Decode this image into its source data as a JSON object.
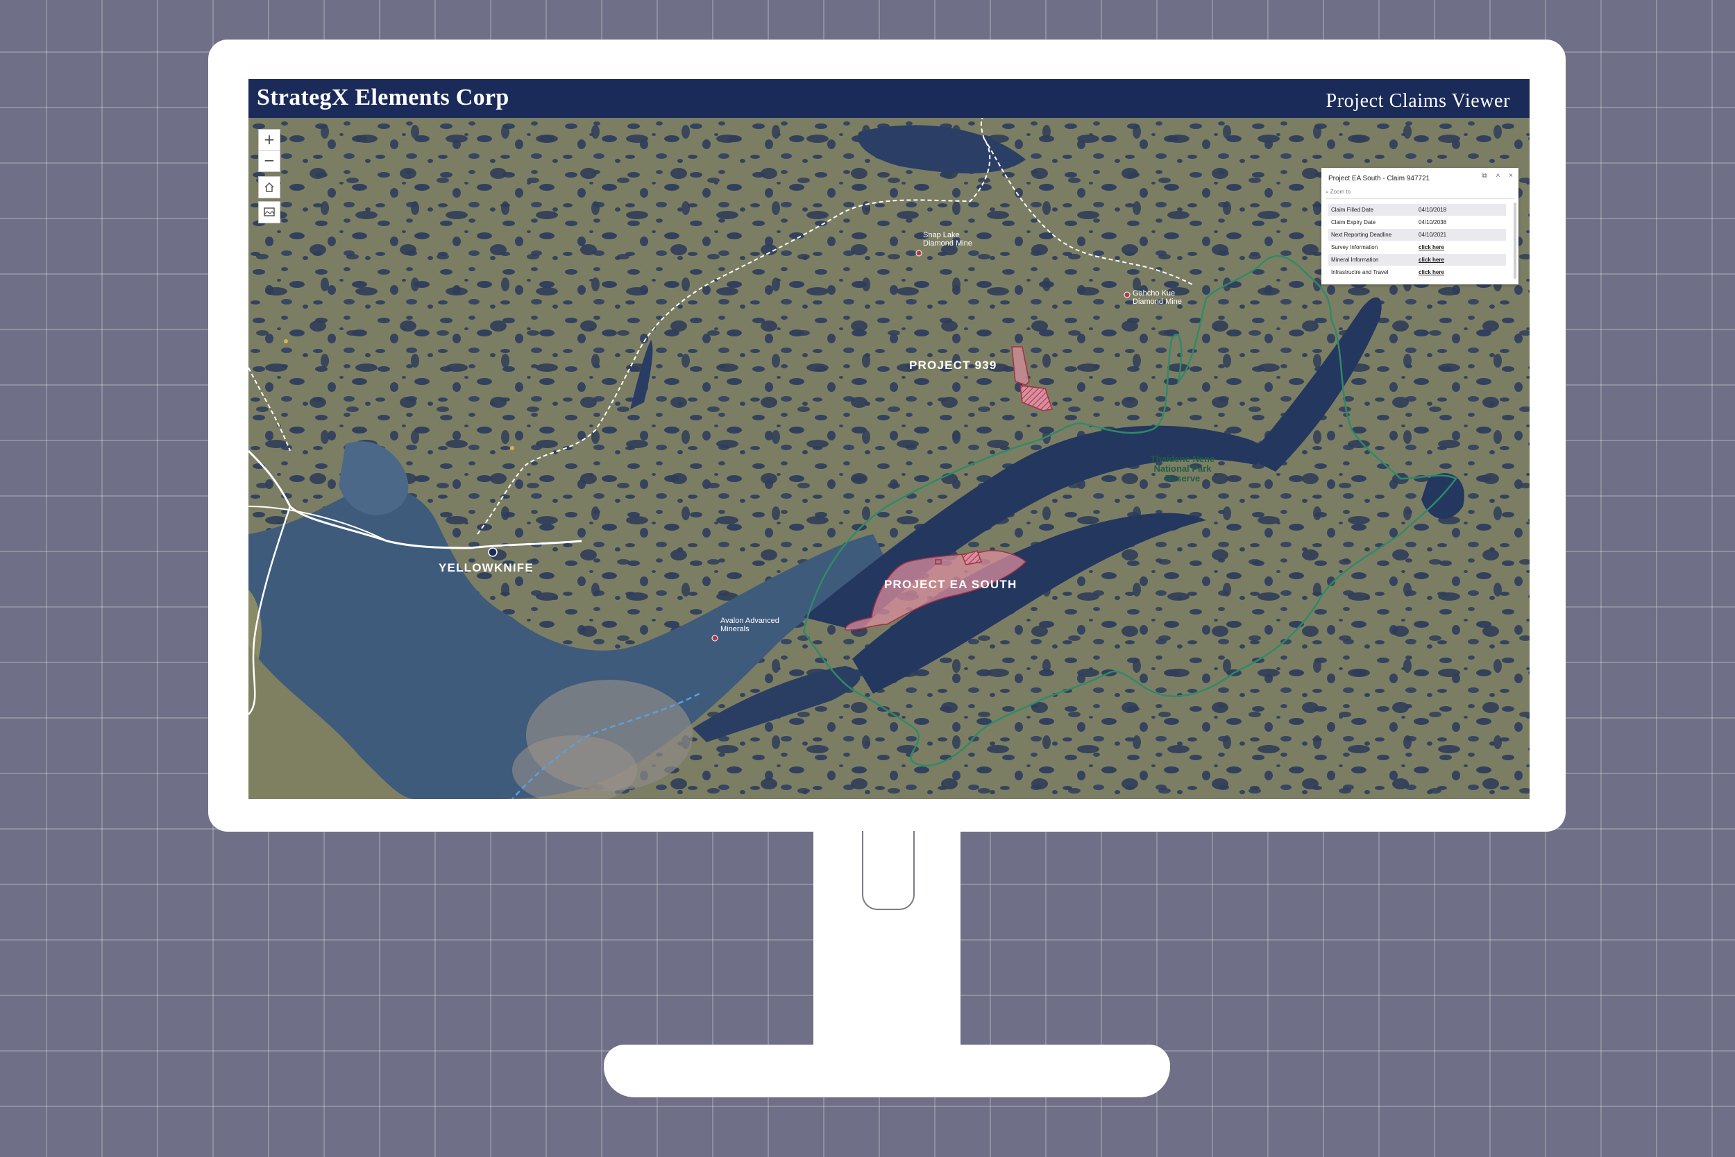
{
  "app": {
    "brand": "StrategX Elements Corp",
    "viewer_title": "Project Claims Viewer"
  },
  "map": {
    "labels": {
      "yellowknife": "YELLOWKNIFE",
      "project_939": "PROJECT 939",
      "project_ea_south": "PROJECT EA SOUTH",
      "snap_lake": [
        "Snap Lake",
        "Diamond Mine"
      ],
      "gahcho_kue": [
        "Gahcho Kue",
        "Diamond Mine"
      ],
      "avalon": [
        "Avalon Advanced",
        "Minerals"
      ],
      "thaidene": [
        "Thaidene Nene",
        "National Park",
        "Reserve"
      ]
    },
    "controls": {
      "zoom_in": "+",
      "zoom_out": "−"
    }
  },
  "popup": {
    "title": "Project EA South - Claim 947721",
    "zoom_label": "Zoom to",
    "rows": [
      {
        "key": "Claim Filled Date",
        "value": "04/10/2018",
        "link": false
      },
      {
        "key": "Claim Expiry Date",
        "value": "04/10/2038",
        "link": false
      },
      {
        "key": "Next Reporting Deadline",
        "value": "04/10/2021",
        "link": false
      },
      {
        "key": "Survey Information",
        "value": "click here",
        "link": true
      },
      {
        "key": "Mineral Information",
        "value": "click here",
        "link": true
      },
      {
        "key": "Infrastructre and Travel",
        "value": "click here",
        "link": true
      }
    ]
  },
  "colors": {
    "header": "#1b2b59",
    "land": "#7a7d63",
    "water": "#22345a",
    "park_boundary": "#2f8a68",
    "claim": "#d98e9d"
  }
}
